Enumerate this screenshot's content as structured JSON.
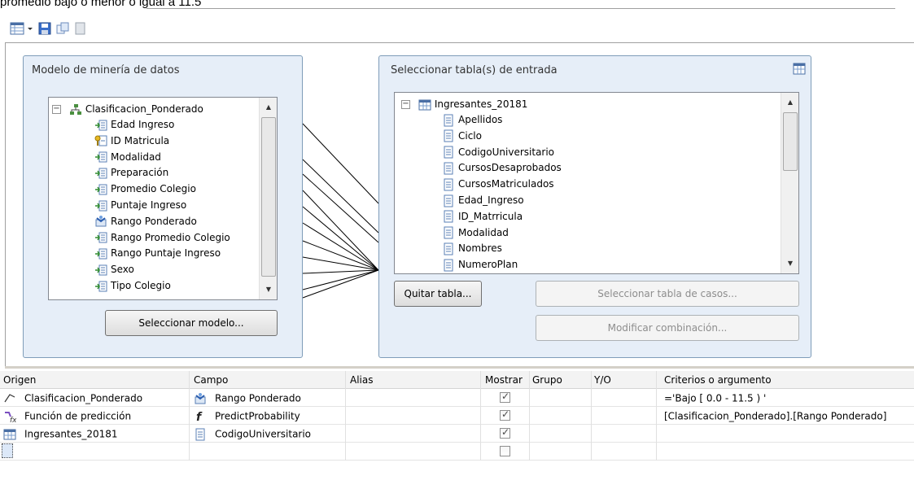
{
  "top_text": "promedio bajo o menor o igual a 11.5",
  "toolbar": {
    "icons": [
      "grid-view-icon",
      "dropdown-arrow-icon",
      "save-icon",
      "copy-icon",
      "sheet-icon"
    ]
  },
  "model_panel": {
    "title": "Modelo de minería de datos",
    "root": "Clasificacion_Ponderado",
    "columns": [
      "Edad Ingreso",
      "ID Matricula",
      "Modalidad",
      "Preparación",
      "Promedio Colegio",
      "Puntaje Ingreso",
      "Rango Ponderado",
      "Rango Promedio Colegio",
      "Rango Puntaje Ingreso",
      "Sexo",
      "Tipo Colegio"
    ],
    "select_button": "Seleccionar modelo..."
  },
  "input_panel": {
    "title": "Seleccionar tabla(s) de entrada",
    "root": "Ingresantes_20181",
    "columns": [
      "Apellidos",
      "Ciclo",
      "CodigoUniversitario",
      "CursosDesaprobados",
      "CursosMatriculados",
      "Edad_Ingreso",
      "ID_Matrricula",
      "Modalidad",
      "Nombres",
      "NumeroPlan"
    ],
    "remove_button": "Quitar tabla...",
    "case_button": "Seleccionar tabla de casos...",
    "join_button": "Modificar combinación..."
  },
  "grid": {
    "headers": [
      "Origen",
      "Campo",
      "Alias",
      "Mostrar",
      "Grupo",
      "Y/O",
      "Criterios o argumento"
    ],
    "rows": [
      {
        "origin": "Clasificacion_Ponderado",
        "origin_icon": "mining-model-icon",
        "field": "Rango Ponderado",
        "field_icon": "predict-column-icon",
        "alias": "",
        "show": true,
        "group": "",
        "andor": "",
        "criteria": "='Bajo [ 0.0 - 11.5 ) '"
      },
      {
        "origin": "Función de predicción",
        "origin_icon": "prediction-function-icon",
        "field": "PredictProbability",
        "field_icon": "function-icon",
        "alias": "",
        "show": true,
        "group": "",
        "andor": "",
        "criteria": "[Clasificacion_Ponderado].[Rango Ponderado]"
      },
      {
        "origin": "Ingresantes_20181",
        "origin_icon": "table-icon",
        "field": "CodigoUniversitario",
        "field_icon": "column-icon",
        "alias": "",
        "show": true,
        "group": "",
        "andor": "",
        "criteria": ""
      },
      {
        "origin": "",
        "origin_icon": "",
        "field": "",
        "field_icon": "",
        "alias": "",
        "show": false,
        "group": "",
        "andor": "",
        "criteria": ""
      }
    ]
  }
}
